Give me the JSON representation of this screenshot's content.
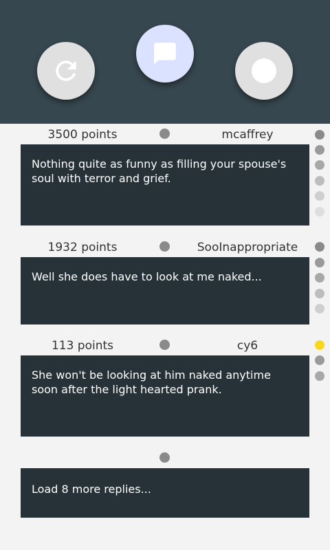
{
  "header": {
    "buttons": [
      "refresh-icon",
      "chat-icon",
      "record-icon"
    ]
  },
  "comments": [
    {
      "points": "3500 points",
      "author": "mcaffrey",
      "text": "Nothing quite as funny as filling your spouse's soul with terror and grief."
    },
    {
      "points": "1932 points",
      "author": "SooInappropriate",
      "text": "Well she does have to look at me naked..."
    },
    {
      "points": "113 points",
      "author": "cy6",
      "text": "She won't be looking at him naked anytime soon after the light hearted prank."
    }
  ],
  "load_more": "Load 8 more replies...",
  "colors": {
    "header": "#37474f",
    "card": "#263238",
    "highlight_dot": "#f9d71c",
    "chat_fab": "#dbe2ff"
  }
}
